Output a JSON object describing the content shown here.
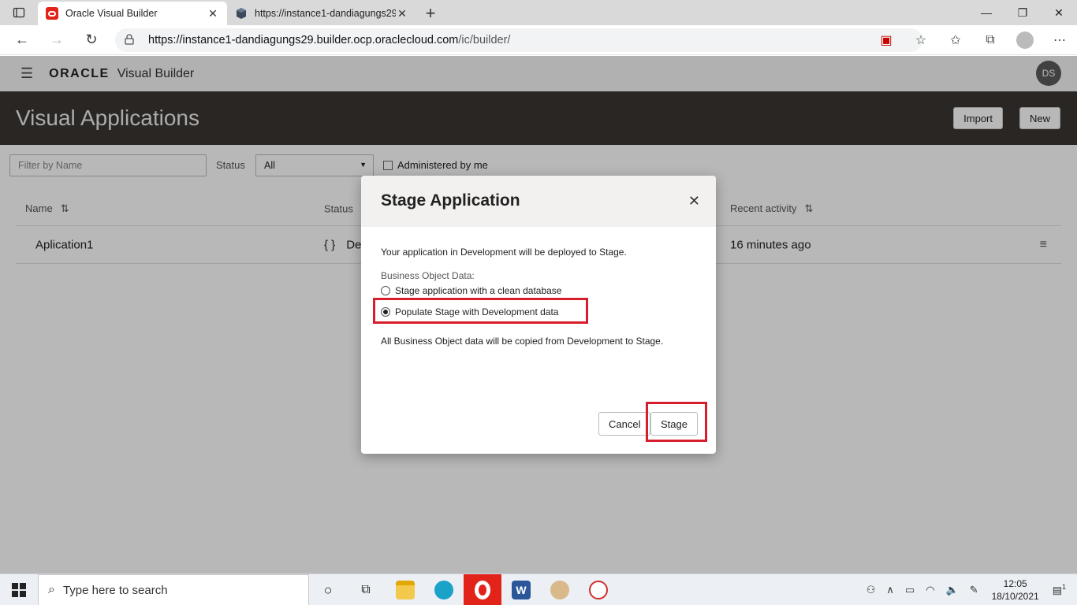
{
  "browser": {
    "tabs": [
      {
        "title": "Oracle Visual Builder",
        "favicon_color": "#e2231a",
        "active": true
      },
      {
        "title": "https://instance1-dandiagungs29",
        "favicon_color": "#444444",
        "active": false
      }
    ],
    "new_tab": "+",
    "url_main": "https://instance1-dandiagungs29.builder.ocp.oraclecloud.com",
    "url_path": "/ic/builder/"
  },
  "app": {
    "logo": "ORACLE",
    "product": "Visual Builder",
    "avatar": "DS",
    "page_title": "Visual Applications",
    "import_label": "Import",
    "new_label": "New",
    "filter_placeholder": "Filter by Name",
    "status_label": "Status",
    "status_value": "All",
    "administered_label": "Administered by me",
    "columns": {
      "name": "Name",
      "status": "Status",
      "recent": "Recent activity"
    },
    "rows": [
      {
        "name": "Aplication1",
        "status_icon": "{ }",
        "status": "Dev",
        "recent": "16 minutes ago"
      }
    ]
  },
  "dialog": {
    "title": "Stage Application",
    "intro": "Your application in Development will be deployed to Stage.",
    "section_label": "Business Object Data:",
    "options": [
      {
        "label": "Stage application with a clean database",
        "selected": false
      },
      {
        "label": "Populate Stage with Development data",
        "selected": true
      }
    ],
    "note": "All Business Object data will be copied from Development to Stage.",
    "cancel_label": "Cancel",
    "stage_label": "Stage",
    "highlight_color": "#d81e2d"
  },
  "taskbar": {
    "search_placeholder": "Type here to search",
    "time": "12:05",
    "date": "18/10/2021",
    "notification_count": "1"
  }
}
